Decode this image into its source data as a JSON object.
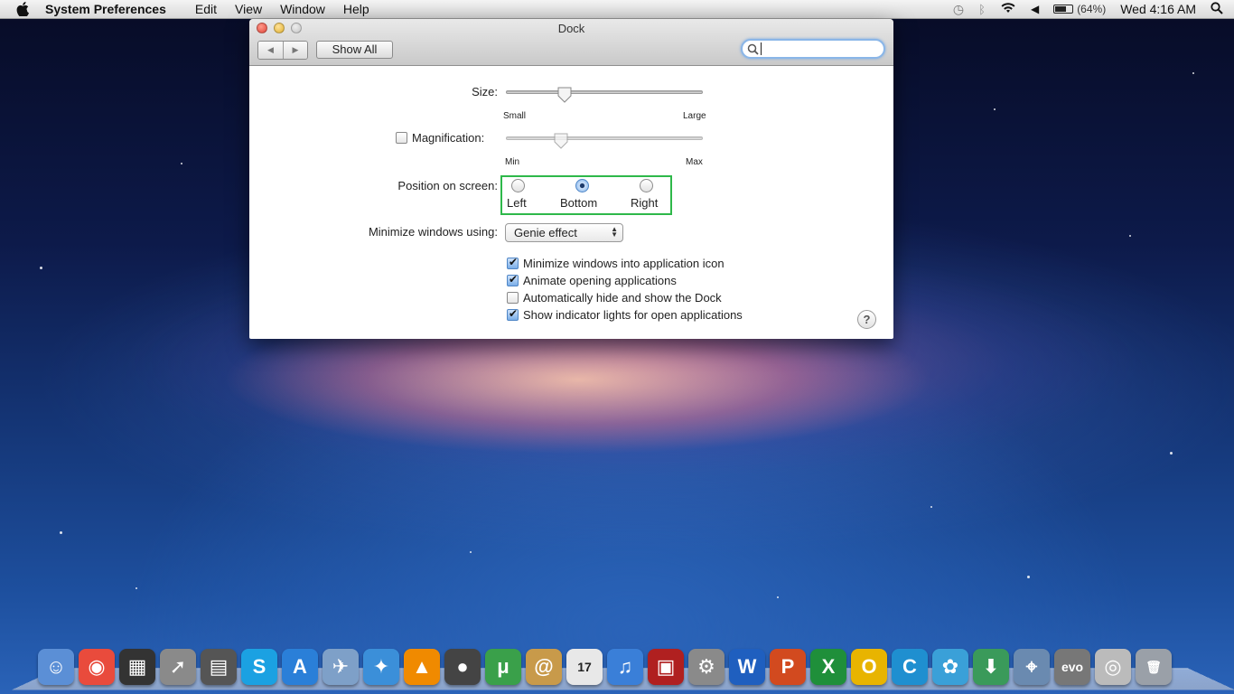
{
  "menubar": {
    "app_name": "System Preferences",
    "items": [
      "Edit",
      "View",
      "Window",
      "Help"
    ],
    "battery": "(64%)",
    "clock": "Wed 4:16 AM"
  },
  "window": {
    "title": "Dock",
    "show_all": "Show All",
    "search_placeholder": ""
  },
  "dock_prefs": {
    "size": {
      "label": "Size:",
      "min_label": "Small",
      "max_label": "Large",
      "value_fraction": 0.3
    },
    "magnification": {
      "label": "Magnification:",
      "checked": false,
      "min_label": "Min",
      "max_label": "Max",
      "value_fraction": 0.28
    },
    "position": {
      "label": "Position on screen:",
      "options": [
        "Left",
        "Bottom",
        "Right"
      ],
      "selected": "Bottom"
    },
    "minimize": {
      "label": "Minimize windows using:",
      "value": "Genie effect"
    },
    "checkboxes": [
      {
        "label": "Minimize windows into application icon",
        "checked": true
      },
      {
        "label": "Animate opening applications",
        "checked": true
      },
      {
        "label": "Automatically hide and show the Dock",
        "checked": false
      },
      {
        "label": "Show indicator lights for open applications",
        "checked": true
      }
    ],
    "help": "?"
  },
  "colors": {
    "highlight": "#2eb84a",
    "accent": "#4f86c6"
  },
  "dock": {
    "apps": [
      {
        "name": "finder-icon",
        "glyph": "☺",
        "bg": "#5b8fd6"
      },
      {
        "name": "chrome-icon",
        "glyph": "◉",
        "bg": "#e94b3c"
      },
      {
        "name": "final-cut-icon",
        "glyph": "▦",
        "bg": "#333333"
      },
      {
        "name": "launchpad-icon",
        "glyph": "➚",
        "bg": "#8a8a8a"
      },
      {
        "name": "dashboard-icon",
        "glyph": "▤",
        "bg": "#555555"
      },
      {
        "name": "skype-icon",
        "glyph": "S",
        "bg": "#1ba1e2"
      },
      {
        "name": "app-store-icon",
        "glyph": "A",
        "bg": "#2a7fd8"
      },
      {
        "name": "preview-icon",
        "glyph": "✈",
        "bg": "#7ea0c8"
      },
      {
        "name": "safari-icon",
        "glyph": "✦",
        "bg": "#3b8fd9"
      },
      {
        "name": "vlc-icon",
        "glyph": "▲",
        "bg": "#f08a00"
      },
      {
        "name": "facetime-icon",
        "glyph": "●",
        "bg": "#444444"
      },
      {
        "name": "utorrent-icon",
        "glyph": "μ",
        "bg": "#3aa04a"
      },
      {
        "name": "address-book-icon",
        "glyph": "@",
        "bg": "#c89a4a"
      },
      {
        "name": "ical-icon",
        "glyph": "17",
        "bg": "#e8e8e8"
      },
      {
        "name": "itunes-icon",
        "glyph": "♫",
        "bg": "#3a7fd8"
      },
      {
        "name": "photo-booth-icon",
        "glyph": "▣",
        "bg": "#b02020"
      },
      {
        "name": "system-preferences-icon",
        "glyph": "⚙",
        "bg": "#8a8a8a"
      },
      {
        "name": "word-icon",
        "glyph": "W",
        "bg": "#1f5fbf"
      },
      {
        "name": "powerpoint-icon",
        "glyph": "P",
        "bg": "#d24a1f"
      },
      {
        "name": "excel-icon",
        "glyph": "X",
        "bg": "#1f8f3a"
      },
      {
        "name": "outlook-icon",
        "glyph": "O",
        "bg": "#e8b400"
      },
      {
        "name": "communicator-icon",
        "glyph": "C",
        "bg": "#1f8fd0"
      },
      {
        "name": "messenger-icon",
        "glyph": "✿",
        "bg": "#3aa0d8"
      },
      {
        "name": "downloads-icon",
        "glyph": "⬇",
        "bg": "#3a9a5a"
      },
      {
        "name": "network-icon",
        "glyph": "⌖",
        "bg": "#6a8ab0"
      },
      {
        "name": "evo-icon",
        "glyph": "evo",
        "bg": "#777777"
      },
      {
        "name": "camera-icon",
        "glyph": "◎",
        "bg": "#bbbbbb"
      },
      {
        "name": "trash-icon",
        "glyph": "🗑",
        "bg": "#9aa0a8"
      }
    ]
  }
}
